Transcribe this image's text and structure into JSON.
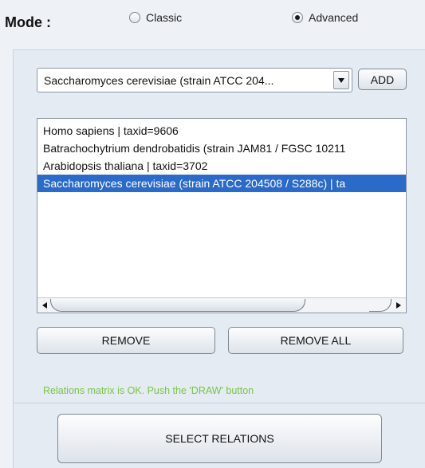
{
  "mode": {
    "label": "Mode :",
    "options": [
      {
        "label": "Classic",
        "selected": false
      },
      {
        "label": "Advanced",
        "selected": true
      }
    ]
  },
  "species_select": {
    "value": "Saccharomyces cerevisiae (strain ATCC 204...",
    "add_label": "ADD"
  },
  "species_list": {
    "items": [
      {
        "label": "Homo sapiens | taxid=9606",
        "selected": false
      },
      {
        "label": "Batrachochytrium dendrobatidis (strain JAM81 / FGSC 10211",
        "selected": false
      },
      {
        "label": "Arabidopsis thaliana | taxid=3702",
        "selected": false
      },
      {
        "label": "Saccharomyces cerevisiae (strain ATCC 204508 / S288c) | ta",
        "selected": true
      }
    ]
  },
  "actions": {
    "remove_label": "REMOVE",
    "remove_all_label": "REMOVE ALL",
    "select_relations_label": "SELECT RELATIONS"
  },
  "status": {
    "message": "Relations matrix is OK. Push the 'DRAW' button",
    "color": "#7ac443"
  },
  "colors": {
    "selection": "#2a6ac9",
    "panel_bg": "#e4ebf3"
  }
}
